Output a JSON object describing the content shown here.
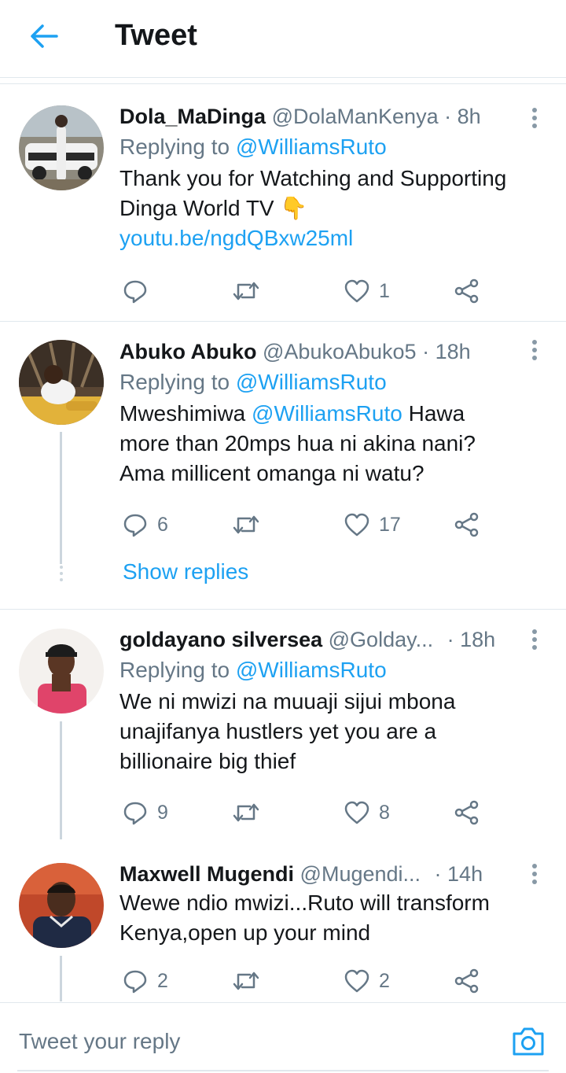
{
  "header": {
    "title": "Tweet",
    "accent_color": "#1da1f2"
  },
  "tweets": [
    {
      "name": "Dola_MaDinga",
      "handle": "@DolaManKenya",
      "time": "· 8h",
      "replying_prefix": "Replying to",
      "replying_to": "@WilliamsRuto",
      "text_line1": "Thank you for Watching and Supporting",
      "text_line2": "Dinga World TV 👇",
      "link": "youtu.be/ngdQBxw25ml",
      "replies": "",
      "retweets": "",
      "likes": "1"
    },
    {
      "name": "Abuko Abuko",
      "handle": "@AbukoAbuko5",
      "time": "· 18h",
      "replying_prefix": "Replying to",
      "replying_to": "@WilliamsRuto",
      "text_prefix": "Mweshimiwa",
      "text_mention": "@WilliamsRuto",
      "text_line1_rest": " Hawa",
      "text_line2": "more than 20mps hua ni akina nani?",
      "text_line3": "Ama millicent omanga ni watu?",
      "replies": "6",
      "retweets": "",
      "likes": "17",
      "show_replies": "Show replies"
    },
    {
      "name": "goldayano silversea",
      "handle": "@Golday...",
      "time": "· 18h",
      "replying_prefix": "Replying to",
      "replying_to": "@WilliamsRuto",
      "text_line1": "We ni mwizi na muuaji sijui mbona",
      "text_line2": "unajifanya hustlers yet you are a",
      "text_line3": "billionaire big thief",
      "replies": "9",
      "retweets": "",
      "likes": "8"
    },
    {
      "name": "Maxwell Mugendi",
      "handle": "@Mugendi...",
      "time": "· 14h",
      "text_line1": "Wewe ndio mwizi...Ruto will transform",
      "text_line2": "Kenya,open up your mind",
      "replies": "2",
      "retweets": "",
      "likes": "2"
    }
  ],
  "reply_bar": {
    "placeholder": "Tweet your reply"
  }
}
